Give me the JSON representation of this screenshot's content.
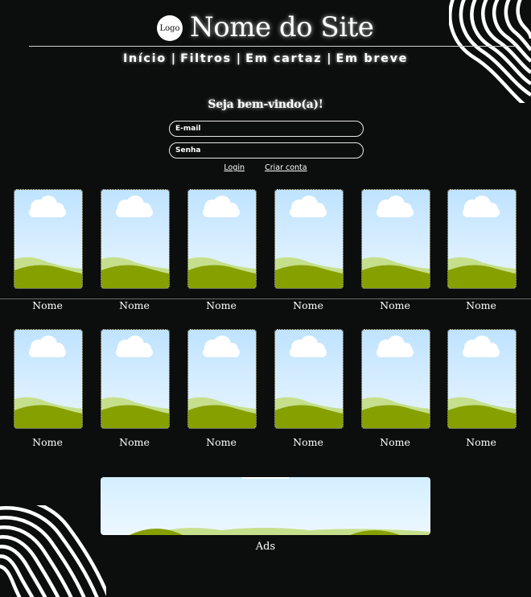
{
  "header": {
    "logo_text": "Logo",
    "site_title": "Nome do Site"
  },
  "nav": {
    "items": [
      "Início",
      "Filtros",
      "Em cartaz",
      "Em breve"
    ],
    "separator": "|"
  },
  "login": {
    "welcome": "Seja bem-vindo(a)!",
    "email_placeholder": "E-mail",
    "password_placeholder": "Senha",
    "login_link": "Login",
    "signup_link": "Criar conta"
  },
  "catalog": {
    "rows": [
      [
        {
          "name": "Nome"
        },
        {
          "name": "Nome"
        },
        {
          "name": "Nome"
        },
        {
          "name": "Nome"
        },
        {
          "name": "Nome"
        },
        {
          "name": "Nome"
        }
      ],
      [
        {
          "name": "Nome"
        },
        {
          "name": "Nome"
        },
        {
          "name": "Nome"
        },
        {
          "name": "Nome"
        },
        {
          "name": "Nome"
        },
        {
          "name": "Nome"
        }
      ]
    ]
  },
  "ads": {
    "label": "Ads"
  },
  "colors": {
    "background": "#0c0d0d",
    "text": "#ffffff",
    "sky_top": "#bfe3ff",
    "sky_bottom": "#eaf6ff",
    "hill_light": "#c6df8c",
    "hill_dark": "#86a000"
  },
  "icons": {
    "placeholder_image": "landscape-placeholder-icon",
    "decoration": "wavy-lines-decoration"
  }
}
